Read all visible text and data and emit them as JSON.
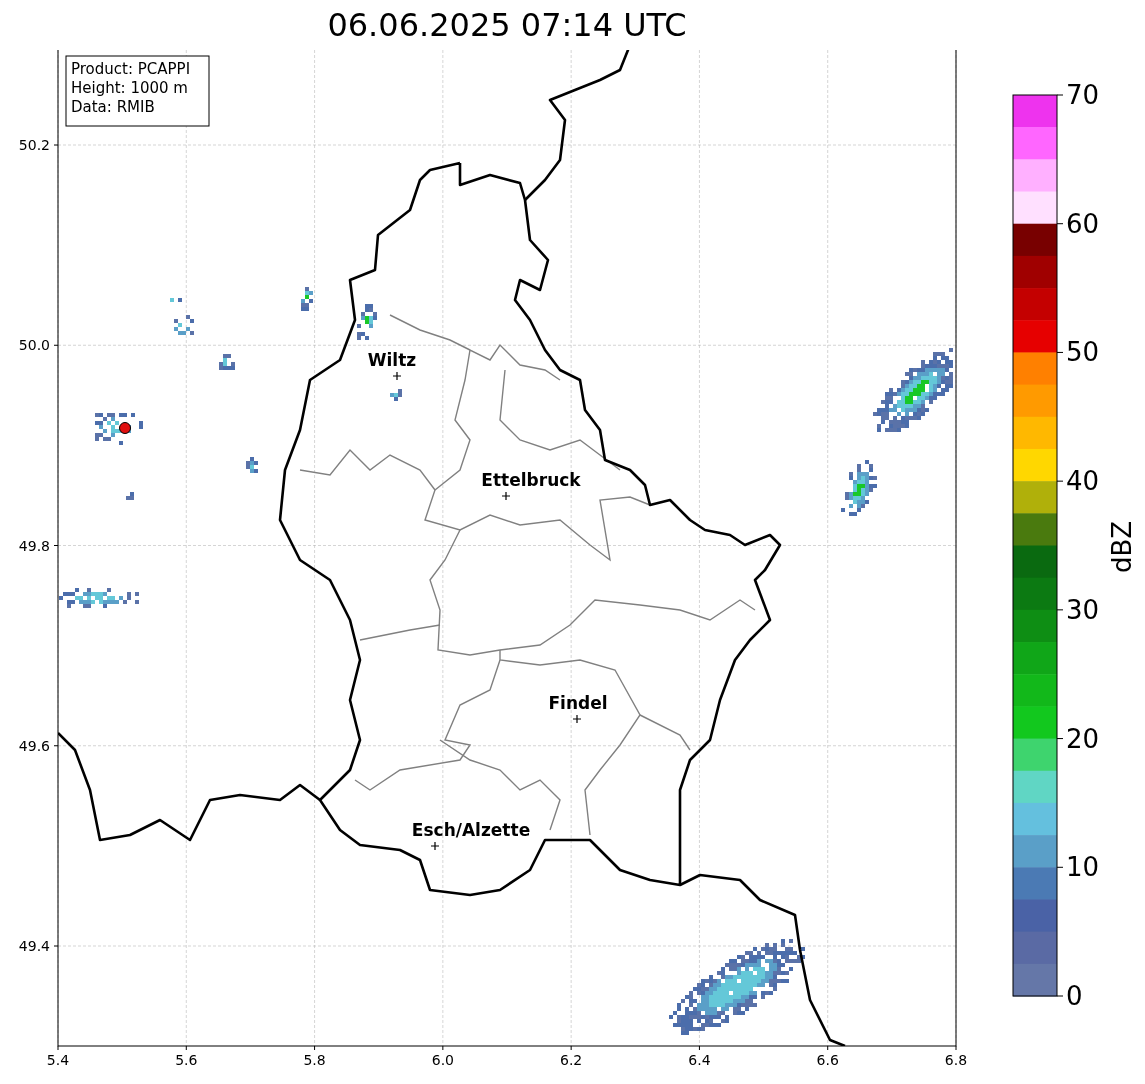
{
  "title": "06.06.2025 07:14 UTC",
  "info_box": [
    "Product: PCAPPI",
    "Height: 1000 m",
    "Data: RMIB"
  ],
  "map": {
    "x_ticks": [
      "5.4",
      "5.6",
      "5.8",
      "6.0",
      "6.2",
      "6.4",
      "6.6",
      "6.8"
    ],
    "y_ticks": [
      "50.2",
      "50.0",
      "49.8",
      "49.6",
      "49.4"
    ],
    "places": [
      {
        "name": "Wiltz"
      },
      {
        "name": "Ettelbruck"
      },
      {
        "name": "Findel"
      },
      {
        "name": "Esch/Alzette"
      }
    ]
  },
  "colorbar": {
    "label": "dBZ",
    "ticks": [
      "70",
      "60",
      "50",
      "40",
      "30",
      "20",
      "10",
      "0"
    ],
    "segments": [
      {
        "color": "#ee33ee"
      },
      {
        "color": "#ff66ff"
      },
      {
        "color": "#ffb0ff"
      },
      {
        "color": "#ffe0ff"
      },
      {
        "color": "#780000"
      },
      {
        "color": "#a00000"
      },
      {
        "color": "#c40000"
      },
      {
        "color": "#e60000"
      },
      {
        "color": "#ff8000"
      },
      {
        "color": "#ff9a00"
      },
      {
        "color": "#ffb800"
      },
      {
        "color": "#ffd700"
      },
      {
        "color": "#b0b00a"
      },
      {
        "color": "#4a7a0e"
      },
      {
        "color": "#0a6a10"
      },
      {
        "color": "#0c7a12"
      },
      {
        "color": "#0e8e14"
      },
      {
        "color": "#10a618"
      },
      {
        "color": "#12b81a"
      },
      {
        "color": "#12c81e"
      },
      {
        "color": "#3ed46e"
      },
      {
        "color": "#60d6c4"
      },
      {
        "color": "#64c0de"
      },
      {
        "color": "#5a9fc8"
      },
      {
        "color": "#4b7ab4"
      },
      {
        "color": "#4a62a6"
      },
      {
        "color": "#5a6aa4"
      },
      {
        "color": "#6577a8"
      }
    ]
  }
}
